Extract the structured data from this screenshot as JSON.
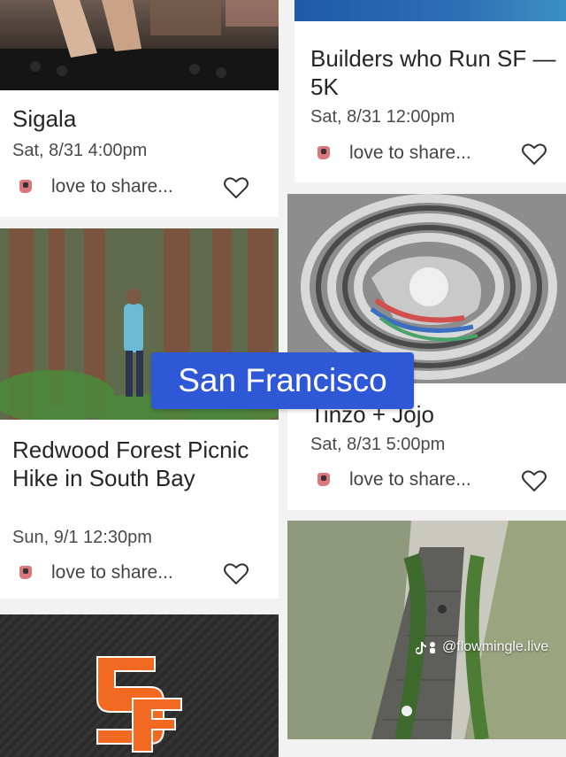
{
  "events": [
    {
      "title": "Sigala",
      "date": "Sat, 8/31 4:00pm",
      "share_text": "love to share...",
      "image": "dj-decks-photo"
    },
    {
      "title": "Builders who Run SF — 5K",
      "date": "Sat, 8/31 12:00pm",
      "share_text": "love to share...",
      "image": "blue-gradient-banner"
    },
    {
      "title": "Redwood Forest Picnic Hike in South Bay",
      "date": "Sun, 9/1 12:30pm",
      "share_text": "love to share...",
      "image": "redwood-forest-photo"
    },
    {
      "title": "Tinzo + Jojo",
      "date": "Sat, 8/31 5:00pm",
      "share_text": "love to share...",
      "image": "swirl-art-image"
    },
    {
      "title": "",
      "date": "",
      "share_text": "",
      "image": "sf-giants-logo"
    },
    {
      "title": "",
      "date": "",
      "share_text": "",
      "image": "stairs-hillside-photo"
    }
  ],
  "overlay": {
    "banner_text": "San Francisco",
    "watermark_text": "@flowmingle.live"
  },
  "colors": {
    "banner": "#2f58d6",
    "background": "#f2f2f2",
    "card": "#ffffff",
    "share_icon": "#d9777c",
    "giants_orange": "#f26a21"
  }
}
